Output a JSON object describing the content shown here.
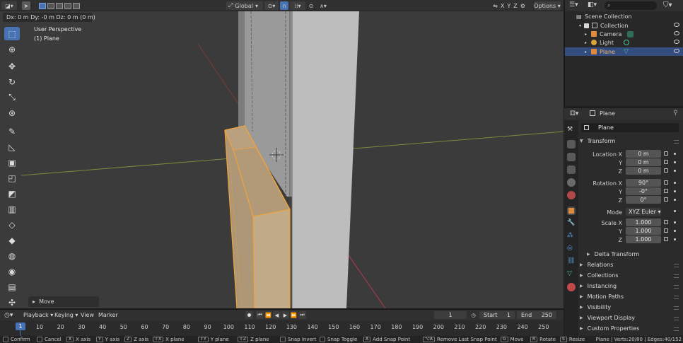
{
  "header": {
    "mode_menu_icon": "object-mode-icon",
    "orientation": "Global",
    "options_label": "Options",
    "gizmo_axes": [
      "X",
      "Y",
      "Z"
    ]
  },
  "operator_readout": "Dx: 0 m  Dy: -0 m  Dz: 0 m (0 m)",
  "viewport": {
    "view_name": "User Perspective",
    "object_label": "(1) Plane",
    "last_operator": "Move"
  },
  "toolbar": {
    "tools": [
      "select-box-icon",
      "cursor-icon",
      "move-icon",
      "rotate-icon",
      "scale-icon",
      "transform-icon",
      "annotate-icon",
      "measure-icon",
      "extrude-region-icon",
      "inset-faces-icon",
      "bevel-icon",
      "loop-cut-icon",
      "knife-icon",
      "poly-build-icon",
      "spin-icon",
      "smooth-icon",
      "edge-slide-icon",
      "shrink-fatten-icon"
    ]
  },
  "outliner": {
    "root": "Scene Collection",
    "collection": "Collection",
    "items": [
      {
        "label": "Camera",
        "color": "#e08a3c"
      },
      {
        "label": "Light",
        "color": "#d8a23a"
      },
      {
        "label": "Plane",
        "color": "#e08a3c",
        "selected": true
      }
    ]
  },
  "properties": {
    "header_object": "Plane",
    "name_field": "Plane",
    "transform_title": "Transform",
    "location_label": "Location X",
    "location": [
      "0 m",
      "0 m",
      "0 m"
    ],
    "rotation_label": "Rotation X",
    "rotation": [
      "90°",
      "-0°",
      "0°"
    ],
    "mode_label": "Mode",
    "mode_value": "XYZ Euler",
    "scale_label": "Scale X",
    "scale": [
      "1.000",
      "1.000",
      "1.000"
    ],
    "axis_y": "Y",
    "axis_z": "Z",
    "sections": [
      "Delta Transform",
      "Relations",
      "Collections",
      "Instancing",
      "Motion Paths",
      "Visibility",
      "Viewport Display",
      "Custom Properties"
    ]
  },
  "timeline": {
    "menus": [
      "Playback",
      "Keying",
      "View",
      "Marker"
    ],
    "current_frame": "1",
    "start_label": "Start",
    "start_value": "1",
    "end_label": "End",
    "end_value": "250",
    "ruler_current": "1",
    "ruler": [
      "10",
      "20",
      "30",
      "40",
      "50",
      "60",
      "70",
      "80",
      "90",
      "100",
      "110",
      "120",
      "130",
      "140",
      "150",
      "160",
      "170",
      "180",
      "190",
      "200",
      "210",
      "220",
      "230",
      "240",
      "250"
    ]
  },
  "statusbar": {
    "items": [
      {
        "key": "",
        "label": "Confirm"
      },
      {
        "key": "",
        "label": "Cancel"
      },
      {
        "key": "X",
        "label": "X axis"
      },
      {
        "key": "Y",
        "label": "Y axis"
      },
      {
        "key": "Z",
        "label": "Z axis"
      },
      {
        "key": "⇧X",
        "label": "X plane"
      },
      {
        "key": "⇧Y",
        "label": "Y plane"
      },
      {
        "key": "⇧Z",
        "label": "Z plane"
      },
      {
        "key": "",
        "label": "Snap Invert"
      },
      {
        "key": "",
        "label": "Snap Toggle"
      },
      {
        "key": "A",
        "label": "Add Snap Point"
      },
      {
        "key": "⌥A",
        "label": "Remove Last Snap Point"
      },
      {
        "key": "G",
        "label": "Move"
      },
      {
        "key": "R",
        "label": "Rotate"
      },
      {
        "key": "S",
        "label": "Resize"
      }
    ],
    "stats": "Plane | Verts:20/80 | Edges:40/152"
  },
  "colors": {
    "accent": "#4772b3",
    "selection_orange": "#f0a33a",
    "viewport_bg": "#3b3b3b",
    "x_axis": "#c0394a",
    "y_axis": "#8aa03a"
  }
}
